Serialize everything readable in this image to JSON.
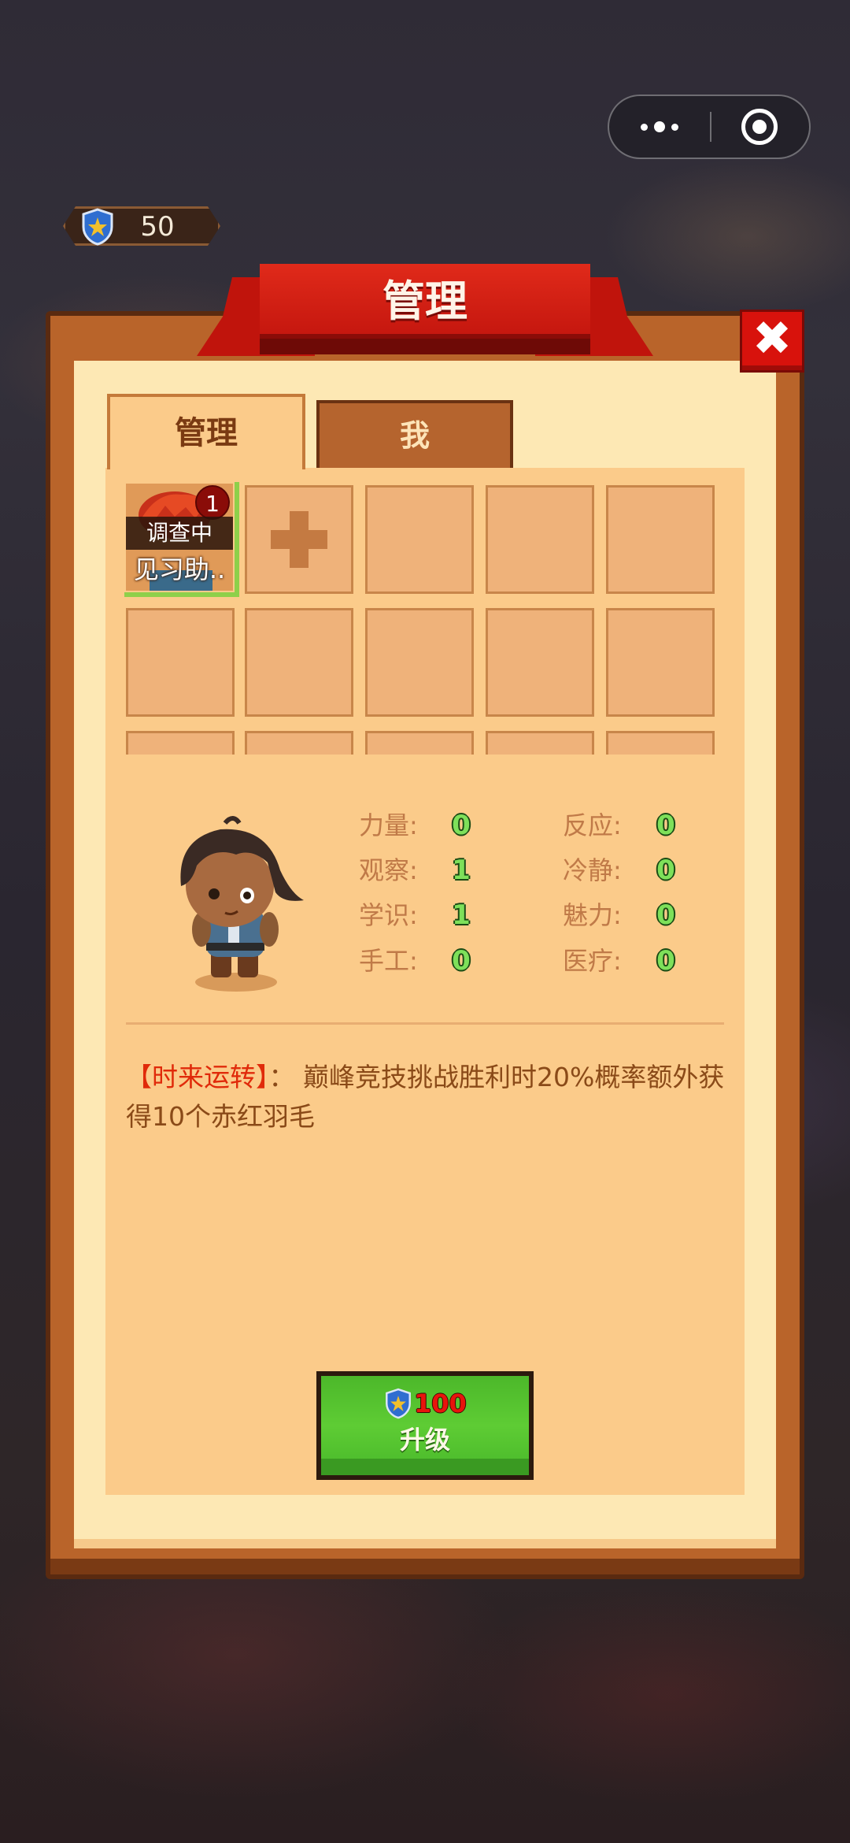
{
  "capsule": {
    "menu_icon": "more-dots-icon",
    "close_icon": "target-circle-icon"
  },
  "currency": {
    "icon": "shield-star-icon",
    "value": "50"
  },
  "header": {
    "title": "管理"
  },
  "close_button": {
    "icon": "close-x-icon",
    "glyph": "✖"
  },
  "tabs": [
    {
      "label": "管理",
      "active": true
    },
    {
      "label": "我",
      "active": false
    }
  ],
  "grid": {
    "selected": {
      "badge": "1",
      "status": "调查中",
      "name": "见习助.."
    },
    "add_icon": "plus-icon"
  },
  "stats": [
    {
      "label": "力量:",
      "value": "0"
    },
    {
      "label": "反应:",
      "value": "0"
    },
    {
      "label": "观察:",
      "value": "1"
    },
    {
      "label": "冷静:",
      "value": "0"
    },
    {
      "label": "学识:",
      "value": "1"
    },
    {
      "label": "魅力:",
      "value": "0"
    },
    {
      "label": "手工:",
      "value": "0"
    },
    {
      "label": "医疗:",
      "value": "0"
    }
  ],
  "description": {
    "highlight": "【时来运转】",
    "text": "： 巅峰竞技挑战胜利时20%概率额外获得10个赤红羽毛"
  },
  "upgrade": {
    "cost": "100",
    "label": "升级",
    "icon": "shield-star-icon"
  },
  "colors": {
    "ribbon": "#d8180e",
    "panel_frame": "#b9642a",
    "panel_inner": "#fde8b4",
    "content": "#fbcb8a",
    "stat_value": "#7ee05a",
    "upgrade_button": "#4cb82a",
    "highlight": "#e02a0a"
  }
}
